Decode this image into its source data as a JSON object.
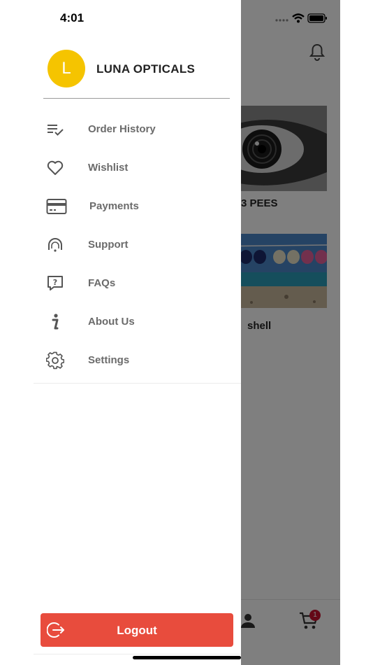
{
  "status_bar": {
    "time": "4:01"
  },
  "background": {
    "card1_title": "3 PEES",
    "card2_title": "shell",
    "cart_badge": "1"
  },
  "drawer": {
    "avatar_letter": "L",
    "brand_name": "LUNA OPTICALS",
    "menu": [
      {
        "label": "Order History",
        "icon": "order-history-icon"
      },
      {
        "label": "Wishlist",
        "icon": "heart-icon"
      },
      {
        "label": "Payments",
        "icon": "credit-card-icon"
      },
      {
        "label": "Support",
        "icon": "support-icon"
      },
      {
        "label": "FAQs",
        "icon": "faq-icon"
      },
      {
        "label": "About Us",
        "icon": "info-icon"
      },
      {
        "label": "Settings",
        "icon": "gear-icon"
      }
    ],
    "logout_label": "Logout"
  },
  "colors": {
    "avatar": "#f5c400",
    "logout": "#e84c3d",
    "badge": "#c8102e"
  }
}
